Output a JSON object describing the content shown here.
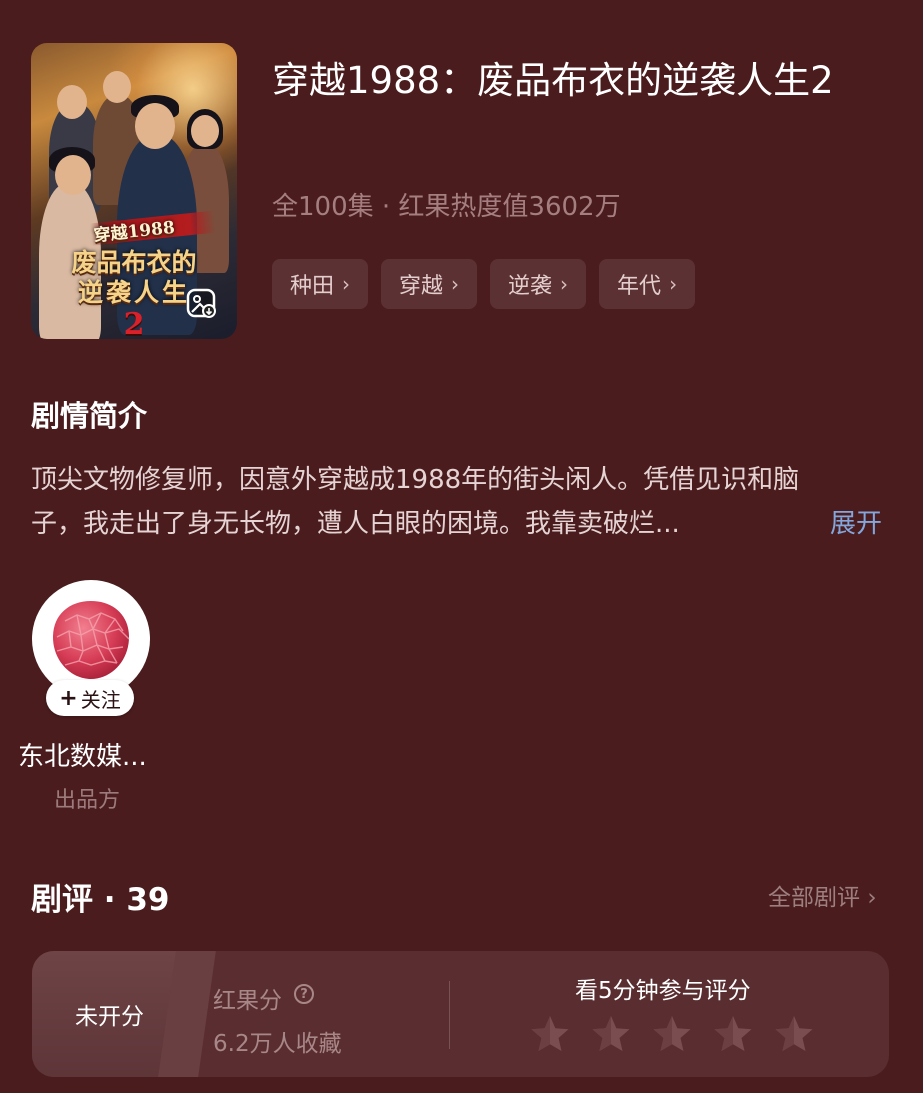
{
  "drama": {
    "title": "穿越1988：废品布衣的逆袭人生2",
    "meta": "全100集 · 红果热度值3602万",
    "poster_text": {
      "line1": "穿越1988",
      "line2": "废品布衣的",
      "line3": "逆袭人生",
      "line4": "2"
    },
    "tags": [
      {
        "label": "种田"
      },
      {
        "label": "穿越"
      },
      {
        "label": "逆袭"
      },
      {
        "label": "年代"
      }
    ]
  },
  "synopsis": {
    "heading": "剧情简介",
    "text": "顶尖文物修复师，因意外穿越成1988年的街头闲人。凭借见识和脑子，我走出了身无长物，遭人白眼的困境。我靠卖破烂...",
    "expand_label": "展开"
  },
  "producer": {
    "name": "东北数媒...",
    "role": "出品方",
    "follow_label": "关注",
    "follow_prefix": "+"
  },
  "reviews": {
    "heading": "剧评 · 39",
    "all_label": "全部剧评",
    "score_label": "未开分",
    "rating_label": "红果分",
    "favorites": "6.2万人收藏",
    "rate_prompt": "看5分钟参与评分",
    "star_count": 5
  },
  "colors": {
    "background": "#4a1c1e",
    "tag_bg": "#5c3133",
    "link_blue": "#83a6dd",
    "muted": "#a57f80",
    "card_bg": "#5a2e31"
  }
}
